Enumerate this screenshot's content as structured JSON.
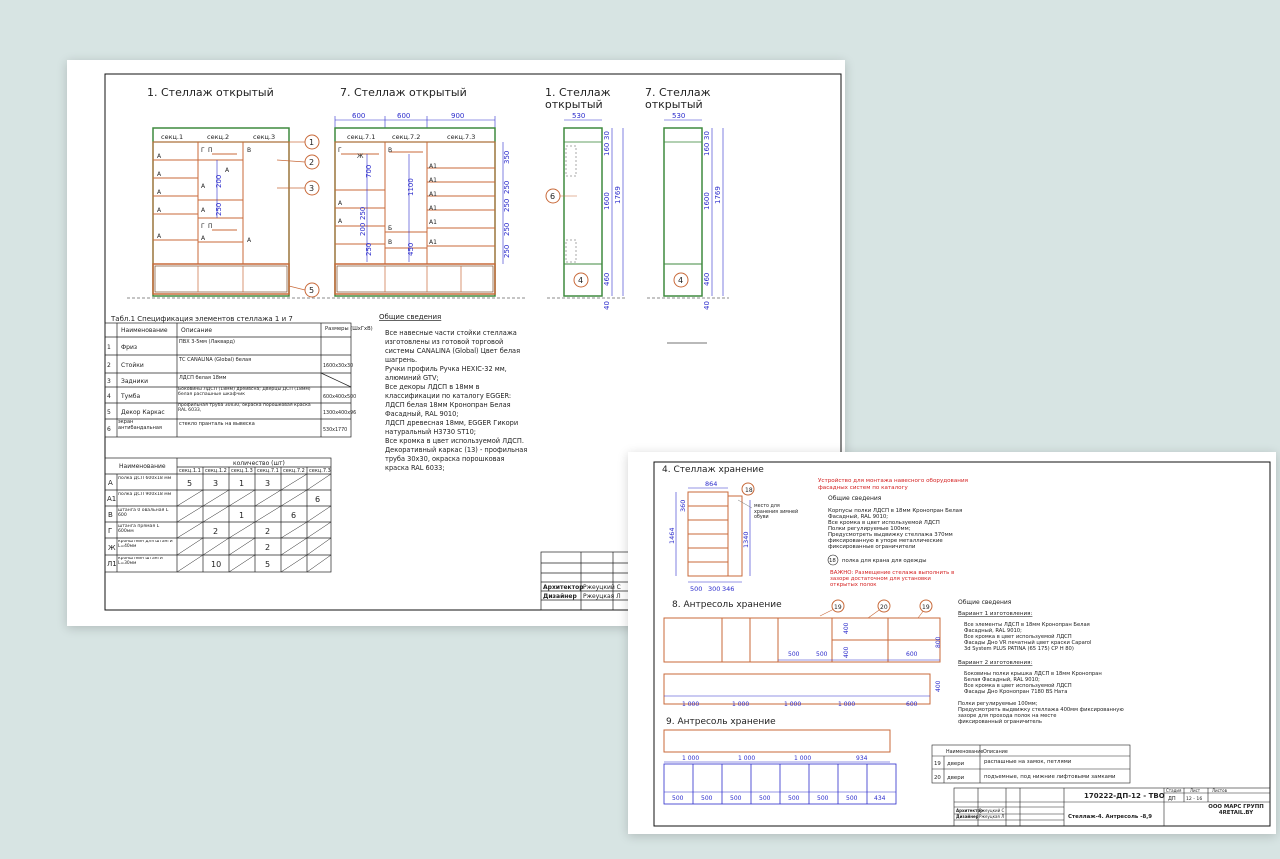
{
  "sheet1": {
    "views": {
      "v1": "1. Стеллаж открытый",
      "v7": "7. Стеллаж открытый",
      "v1side_l1": "1. Стеллаж",
      "v1side_l2": "открытый",
      "v7side_l1": "7. Стеллаж",
      "v7side_l2": "открытый"
    },
    "front1": {
      "sections": [
        "секц.1",
        "секц.2",
        "секц.3"
      ],
      "letters": [
        "А",
        "А",
        "А",
        "А",
        "Г",
        "П",
        "А",
        "Г",
        "А",
        "П",
        "А",
        "А",
        "А",
        "В",
        "А"
      ],
      "dims": [
        "200",
        "250"
      ]
    },
    "front7": {
      "top_dims": [
        "600",
        "600",
        "900"
      ],
      "sections": [
        "секц.7.1",
        "секц.7.2",
        "секц.7.3"
      ],
      "letters": [
        "Г",
        "Ж",
        "В",
        "А1",
        "А1",
        "А1",
        "А1",
        "А1",
        "А1",
        "А",
        "А",
        "Б",
        "В"
      ],
      "dims": [
        "700",
        "1100",
        "450",
        "250",
        "200",
        "250",
        "350",
        "250",
        "250",
        "250",
        "250"
      ]
    },
    "callouts": [
      "1",
      "2",
      "3",
      "5",
      "6",
      "4",
      "4"
    ],
    "side": {
      "width": "530",
      "dims": [
        "160",
        "30",
        "1600",
        "1769",
        "460",
        "40"
      ]
    },
    "table1": {
      "title": "Табл.1 Спецификация элементов стеллажа 1 и 7",
      "headers": [
        "Наименование",
        "Описание",
        "Размеры (ШхГхВ)"
      ],
      "rows": [
        {
          "n": "1",
          "name": "Фриз",
          "desc": "ПВХ 3-5мм (Лаквард)",
          "size": ""
        },
        {
          "n": "2",
          "name": "Стойки",
          "desc": "ТС CANALINA (Global) белая",
          "size": "1600х30х30"
        },
        {
          "n": "3",
          "name": "Задники",
          "desc": "ЛДСП белая 18мм",
          "size": ""
        },
        {
          "n": "4",
          "name": "Тумба",
          "desc": "Боковины ЛДСП (18мм) дрейвсна; Дверцы ДСП (18мм) белая распашные шкафчик",
          "size": "600х400х500"
        },
        {
          "n": "5",
          "name": "Декор Каркас",
          "desc": "профильная труба 30х30, окраска порошковая краска RAL 6033,",
          "size": "1300х400х96"
        },
        {
          "n": "6",
          "name": "экран антибандальная",
          "desc": "стекло пранталь на вывеска",
          "size": "530х1770"
        }
      ]
    },
    "notes": {
      "title": "Общие сведения",
      "lines": [
        "Все навесные части стойки стеллажа",
        "изготовлены из готовой торговой",
        "системы CANALINA (Global) Цвет белая",
        "шагрень.",
        "Ручки профиль Ручка HEXIC-32 мм,",
        "алюминий GTV;",
        "Все декоры ЛДСП в 18мм в",
        "классификации по каталогу EGGER:",
        "ЛДСП белая 18мм Кронопран Белая",
        "Фасадный, RAL 9010;",
        "ЛДСП древесная 18мм, EGGER Гикори",
        "натуральный Н3730 ST10;",
        "Все кромка в цвет используемой ЛДСП.",
        "Декоративный каркас (13) - профильная",
        "труба 30х30, окраска порошковая",
        "краска RAL 6033;"
      ]
    },
    "table2": {
      "title": "количество (шт)",
      "name_header": "Наименование",
      "cols": [
        "секц.1.1",
        "секц.1.2",
        "секц.1.3",
        "секц.7.1",
        "секц.7.2",
        "секц.7.3"
      ],
      "rows": [
        {
          "code": "А",
          "name": "полка ДСП 600х18 мм",
          "vals": [
            "5",
            "3",
            "1",
            "3",
            "",
            ""
          ]
        },
        {
          "code": "А1",
          "name": "полка ДСП 900х18 мм",
          "vals": [
            "",
            "",
            "",
            "",
            "",
            "6"
          ]
        },
        {
          "code": "В",
          "name": "штанга 0 овальная L 600",
          "vals": [
            "",
            "",
            "1",
            "",
            "6",
            ""
          ]
        },
        {
          "code": "Г",
          "name": "штанга прямая L 600мм",
          "vals": [
            "",
            "2",
            "",
            "2",
            "",
            ""
          ]
        },
        {
          "code": "Ж",
          "name": "кронштейн для штанги L=40мм",
          "vals": [
            "",
            "",
            "",
            "2",
            "",
            ""
          ]
        },
        {
          "code": "Л1",
          "name": "кронштейн штанги L=30мм",
          "vals": [
            "",
            "10",
            "",
            "5",
            "",
            ""
          ]
        }
      ]
    },
    "stamp": {
      "architect_label": "Архитектор",
      "architect_name": "Ржеуцкий С",
      "designer_label": "Дизайнер",
      "designer_name": "Ржеуцкая Л"
    }
  },
  "sheet2": {
    "storage": {
      "title": "4. Стеллаж хранение",
      "width": "864",
      "callout": "18",
      "note": "место для хранения зимней обуви",
      "dims": [
        "1464",
        "1340",
        "360",
        "500",
        "300",
        "346"
      ]
    },
    "red_notes": [
      "Устройство для монтажа навесного оборудования",
      "фасадных систем по каталогу"
    ],
    "general": {
      "title": "Общие сведения",
      "lines": [
        "Корпусы полки ЛДСП в 18мм Кронопран Белая",
        "Фасадный, RAL 9010;",
        "Все кромка в цвет используемой ЛДСП",
        "Полки регулируемые 100мм;",
        "Предусмотреть выдвижку стеллажа 370мм",
        "фиксированную в упоре металлические",
        "фиксированные ограничители"
      ],
      "item18": "18",
      "item18_text": "полка для крана для одежды"
    },
    "warning": [
      "ВАЖНО: Размещение стелажа выполнить в",
      "зазоре достаточном для установки",
      "открытых полок"
    ],
    "mezzanine": {
      "title": "8. Антресоль хранение",
      "callouts": [
        "19",
        "20",
        "19"
      ],
      "dims_top": [
        "500",
        "500",
        "600",
        "400",
        "400",
        "800"
      ],
      "dims_bottom": [
        "1 000",
        "1 000",
        "1 000",
        "1 000",
        "600"
      ],
      "dim_side": "400"
    },
    "mezz_notes": {
      "title": "Общие сведения",
      "v1_title": "Вариант 1 изготовления:",
      "v1_lines": [
        "Все элементы ЛДСП в 18мм Кронопран Белая",
        "Фасадный, RAL 9010;",
        "Все кромка в цвет используемой ЛДСП",
        "Фасады Дно VR печатный цвет краски Caparol",
        "3d System PLUS PATINA (65 175) СР Н 80)"
      ],
      "v2_title": "Вариант 2 изготовления:",
      "v2_lines": [
        "Боковины полки крышка ЛДСП в 18мм Кронопран",
        "Белая Фасадный, RAL 9010;",
        "Все кромка в цвет используемой ЛДСП",
        "Фасады Дно Кронопран 7180 BS Ната"
      ],
      "extra_lines": [
        "Полки регулируемые 100мм;",
        "Предусмотреть выдвижку стеллажа 400мм фиксированную",
        "зазоре для прохода полок на месте",
        "фиксированный ограничитель"
      ]
    },
    "storage9": {
      "title": "9. Антресоль хранение",
      "dims_top": [
        "1 000",
        "1 000",
        "1 000",
        "934"
      ],
      "dims_bottom": [
        "500",
        "500",
        "500",
        "500",
        "500",
        "500",
        "500",
        "434"
      ]
    },
    "legend": {
      "headers": [
        "Наименование",
        "Описание"
      ],
      "rows": [
        {
          "n": "19",
          "name": "двери",
          "desc": "распашные на замок, петлями"
        },
        {
          "n": "20",
          "name": "двери",
          "desc": "подъемные, под нижние лифтовыми замками"
        }
      ]
    },
    "titleblock": {
      "code": "170222-ДП-12 - ТВО",
      "stage_h": "Стадия",
      "sheet_h": "Лист",
      "sheets_h": "Листов",
      "stage": "ДП",
      "sheet": "12 - 16",
      "sheet_title": "Стеллаж-4. Антресоль -8,9",
      "company": "ООО МАРС ГРУПП 4RETAIL.BY",
      "architect_label": "Архитектор",
      "architect_name": "Ржеуцкий С",
      "designer_label": "Дизайнер",
      "designer_name": "Ржеуцкая Л"
    }
  },
  "colors": {
    "background": "#d7e4e3",
    "frame_green": "#3f8a3f",
    "panel_orange": "#c86a3a",
    "dimension_blue": "#2c2ccc",
    "note_red": "#d42020"
  }
}
